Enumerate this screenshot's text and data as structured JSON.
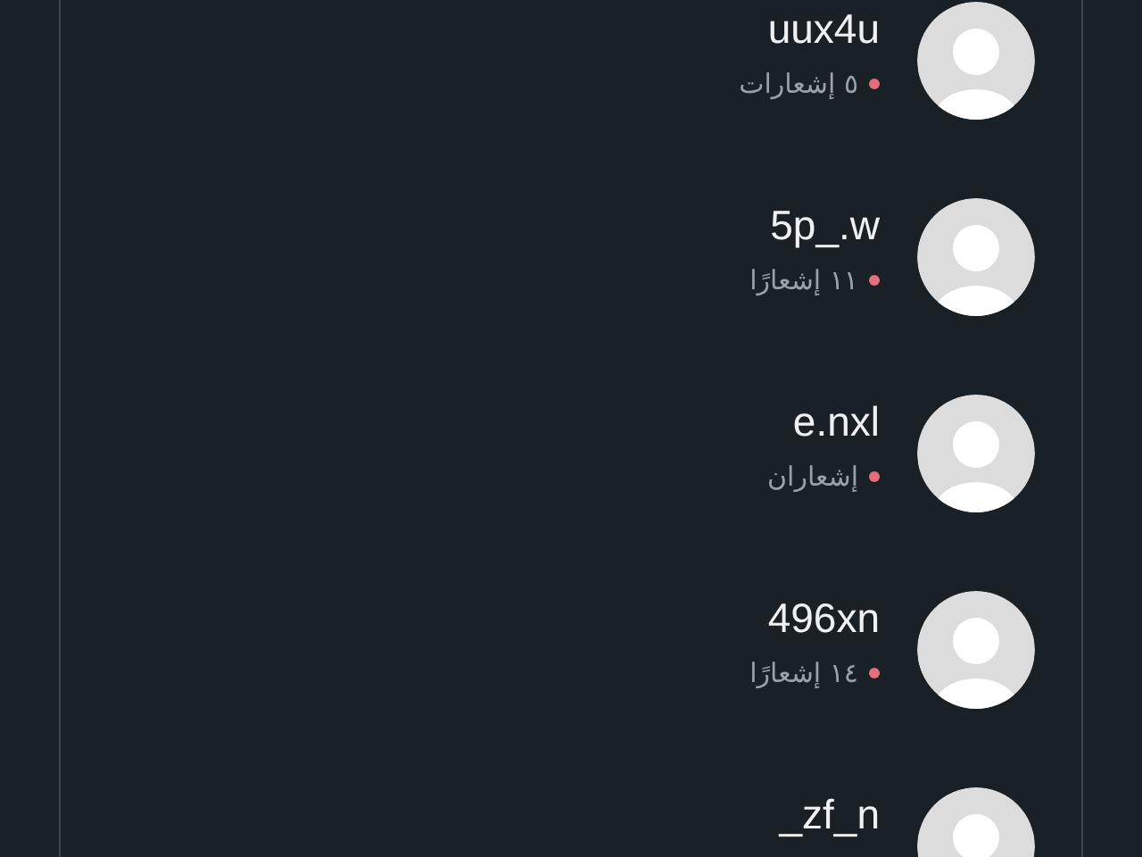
{
  "contacts": [
    {
      "name": "uux4u",
      "notifications": "٥ إشعارات",
      "unread": true
    },
    {
      "name": "5p_.w",
      "notifications": "١١ إشعارًا",
      "unread": true
    },
    {
      "name": "e.nxl",
      "notifications": "إشعاران",
      "unread": true
    },
    {
      "name": "496xn",
      "notifications": "١٤ إشعارًا",
      "unread": true
    },
    {
      "name": "_zf_n"
    }
  ]
}
